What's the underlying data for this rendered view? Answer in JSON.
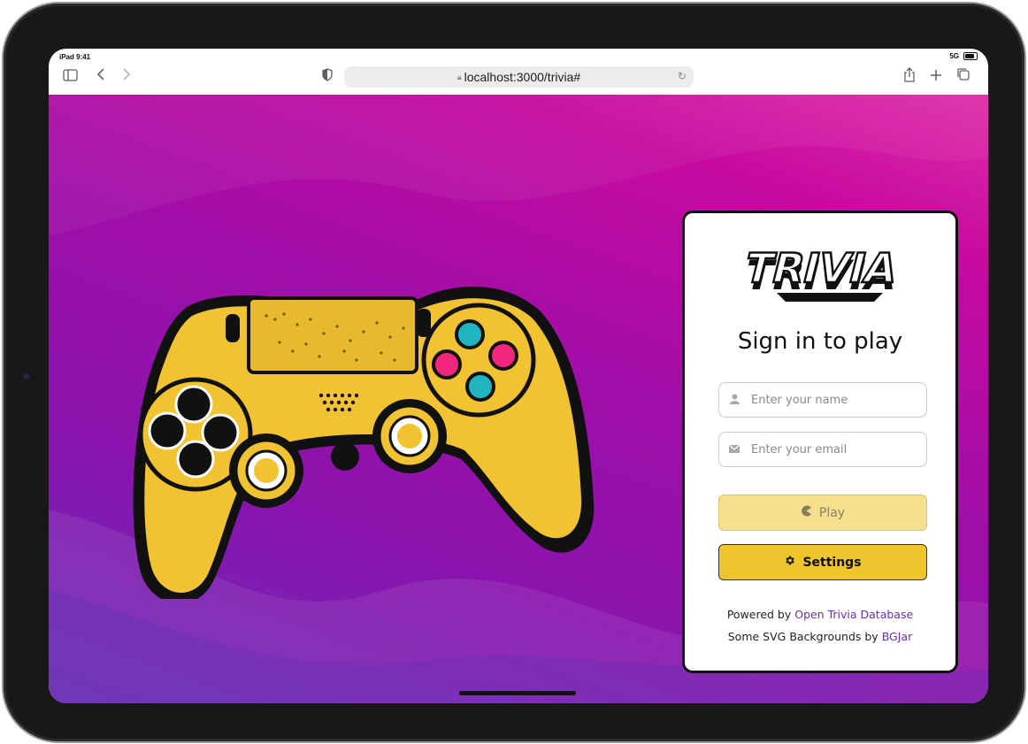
{
  "status_bar": {
    "device_time": "iPad 9:41",
    "network": "5G"
  },
  "browser": {
    "url": "localhost:3000/trivia#",
    "icons": [
      "sidebar-icon",
      "back-icon",
      "forward-icon",
      "privacy-shield-icon",
      "lock-icon",
      "reload-icon",
      "share-icon",
      "new-tab-icon",
      "tabs-icon"
    ]
  },
  "colors": {
    "accent": "#efc52e",
    "play_disabled": "#f5e08f",
    "link": "#6b2fb3",
    "background_magenta": "#c60aa0",
    "background_purple": "#8a14ad"
  },
  "card": {
    "logo_text": "TRIVIA",
    "title": "Sign in to play",
    "name_field": {
      "placeholder": "Enter your name",
      "value": "",
      "icon": "user-icon"
    },
    "email_field": {
      "placeholder": "Enter your email",
      "value": "",
      "icon": "envelope-icon"
    },
    "play_button": {
      "label": "Play",
      "icon": "pacman-icon",
      "enabled": false
    },
    "settings_button": {
      "label": "Settings",
      "icon": "gear-icon"
    },
    "footer": {
      "powered_prefix": "Powered by",
      "powered_link": "Open Trivia Database",
      "bg_prefix": "Some SVG Backgrounds by",
      "bg_link": "BGJar"
    }
  }
}
